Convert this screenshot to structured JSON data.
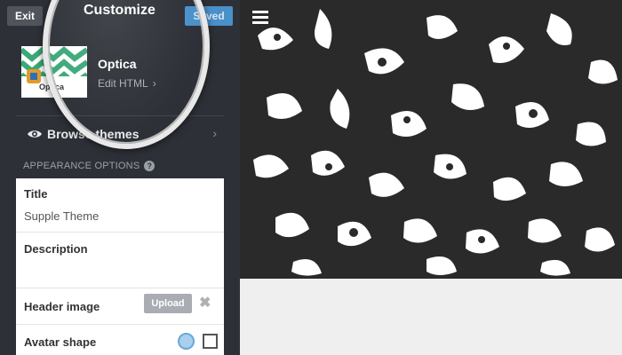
{
  "topbar": {
    "exit_label": "Exit",
    "title": "Customize",
    "saved_label": "Saved"
  },
  "theme": {
    "name": "Optica",
    "edit_label": "Edit HTML",
    "thumbnail_label": "Optica"
  },
  "browse": {
    "label": "Browse themes"
  },
  "appearance": {
    "section_label": "APPEARANCE OPTIONS"
  },
  "fields": {
    "title_label": "Title",
    "title_value": "Supple Theme",
    "description_label": "Description",
    "header_image_label": "Header image",
    "upload_label": "Upload",
    "avatar_shape_label": "Avatar shape"
  },
  "colors": {
    "sidebar": "#2d3137",
    "accent": "#4a90c9",
    "panel": "#ffffff",
    "preview_pattern": "#2a2a2a"
  },
  "icons": [
    "eye-icon",
    "help-icon",
    "chevron-right-icon",
    "close-icon",
    "hamburger-menu-icon"
  ]
}
